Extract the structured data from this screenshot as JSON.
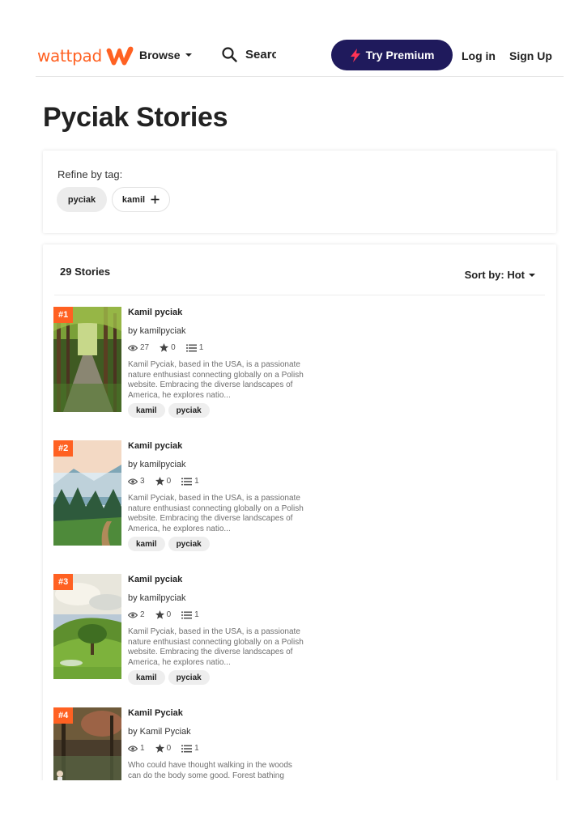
{
  "header": {
    "logo_text": "wattpad",
    "browse_label": "Browse",
    "search_placeholder": "Search",
    "premium_label": "Try Premium",
    "login_label": "Log in",
    "signup_label": "Sign Up"
  },
  "page_title": "Pyciak Stories",
  "refine": {
    "label": "Refine by tag:",
    "tags": [
      "pyciak",
      "kamil"
    ]
  },
  "stories_panel": {
    "count_label": "29 Stories",
    "sort_label": "Sort by: Hot"
  },
  "stories": [
    {
      "rank": "#1",
      "title": "Kamil pyciak",
      "author": "by kamilpyciak",
      "reads": "27",
      "votes": "0",
      "parts": "1",
      "description": "Kamil Pyciak, based in the USA, is a passionate nature enthusiast connecting globally on a Polish website. Embracing the diverse landscapes of America, he explores natio...",
      "tags": [
        "kamil",
        "pyciak"
      ]
    },
    {
      "rank": "#2",
      "title": "Kamil pyciak",
      "author": "by kamilpyciak",
      "reads": "3",
      "votes": "0",
      "parts": "1",
      "description": "Kamil Pyciak, based in the USA, is a passionate nature enthusiast connecting globally on a Polish website. Embracing the diverse landscapes of America, he explores natio...",
      "tags": [
        "kamil",
        "pyciak"
      ]
    },
    {
      "rank": "#3",
      "title": "Kamil pyciak",
      "author": "by kamilpyciak",
      "reads": "2",
      "votes": "0",
      "parts": "1",
      "description": "Kamil Pyciak, based in the USA, is a passionate nature enthusiast connecting globally on a Polish website. Embracing the diverse landscapes of America, he explores natio...",
      "tags": [
        "kamil",
        "pyciak"
      ]
    },
    {
      "rank": "#4",
      "title": "Kamil Pyciak",
      "author": "by Kamil Pyciak",
      "reads": "1",
      "votes": "0",
      "parts": "1",
      "description": "Who could have thought walking in the woods can do the body some good. Forest bathing",
      "tags": []
    }
  ],
  "colors": {
    "brand_orange": "#ff6122",
    "premium_navy": "#1f1a5c",
    "premium_bolt": "#ff3355",
    "tag_bg": "#eeeeee"
  },
  "icons": {
    "search": "search-icon",
    "bolt": "lightning-bolt-icon",
    "reads": "eye-icon",
    "votes": "star-icon",
    "parts": "list-icon",
    "add_tag": "plus-icon"
  }
}
